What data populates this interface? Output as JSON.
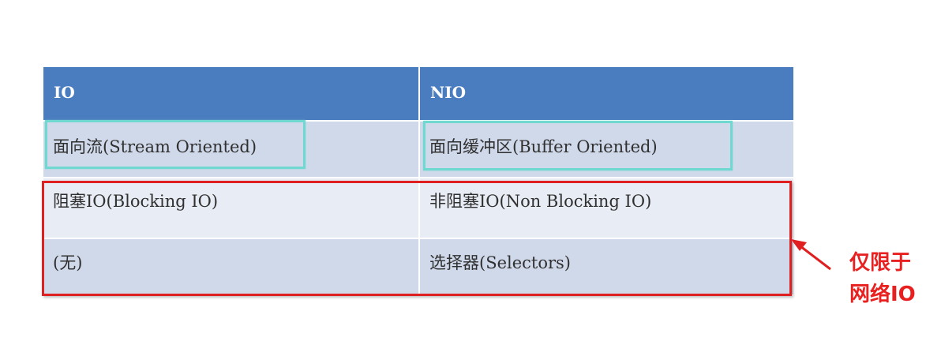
{
  "table": {
    "header": {
      "col1": "IO",
      "col2": "NIO"
    },
    "rows": [
      {
        "col1": "面向流(Stream Oriented)",
        "col2": "面向缓冲区(Buffer Oriented)"
      },
      {
        "col1": "阻塞IO(Blocking IO)",
        "col2": "非阻塞IO(Non Blocking IO)"
      },
      {
        "col1": "(无)",
        "col2": "选择器(Selectors)"
      }
    ]
  },
  "annotation": {
    "line1": "仅限于",
    "line2": "网络IO",
    "color": "#e82020"
  },
  "colors": {
    "header_bg": "#4a7dbf",
    "row_dark": "#d0d9ea",
    "row_light": "#e8ecf4",
    "highlight_teal": "#6fd8d0",
    "highlight_red": "#e02020"
  }
}
